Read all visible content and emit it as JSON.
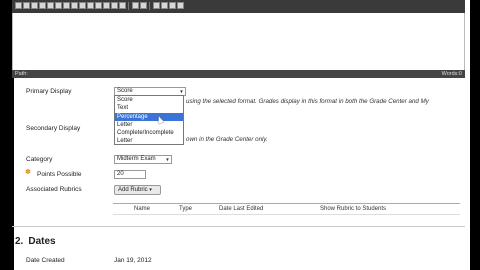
{
  "editor": {
    "status_path": "Path:",
    "word_count": "Words:0"
  },
  "form": {
    "primary_display": {
      "label": "Primary Display",
      "value": "Score",
      "helper": "using the selected format. Grades display in this format in both the Grade Center and My",
      "options": [
        "Score",
        "Text",
        "Percentage",
        "Letter",
        "Complete/Incomplete",
        "Letter"
      ],
      "selected_index": 2
    },
    "secondary_display": {
      "label": "Secondary Display",
      "helper": "own in the Grade Center only."
    },
    "category": {
      "label": "Category",
      "value": "Midterm Exam"
    },
    "points_possible": {
      "label": "Points Possible",
      "required_mark": "✽",
      "value": "20"
    },
    "associated_rubrics": {
      "label": "Associated Rubrics",
      "button": "Add Rubric",
      "columns": [
        "Name",
        "Type",
        "Date Last Edited",
        "Show Rubric to Students"
      ]
    }
  },
  "section2": {
    "number": "2.",
    "title": "Dates",
    "date_created_label": "Date Created",
    "date_created_value": "Jan 19, 2012"
  }
}
